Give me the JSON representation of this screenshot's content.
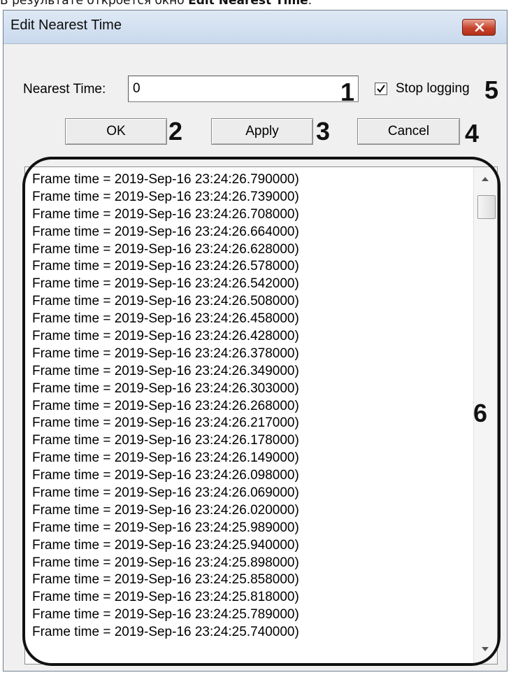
{
  "caption": {
    "prefix": "В результате откроется окно ",
    "bold": "Edit Nearest Time",
    "suffix": "."
  },
  "window": {
    "title": "Edit Nearest Time",
    "close_icon": "close-icon",
    "close_color": "#c7432c"
  },
  "nearest_time": {
    "label": "Nearest Time:",
    "value": "0"
  },
  "stop_logging": {
    "label": "Stop logging",
    "checked": true
  },
  "buttons": {
    "ok": "OK",
    "apply": "Apply",
    "cancel": "Cancel"
  },
  "callouts": {
    "c1": "1",
    "c2": "2",
    "c3": "3",
    "c4": "4",
    "c5": "5",
    "c6": "6"
  },
  "log": {
    "lines": [
      "Frame time = 2019-Sep-16 23:24:26.790000)",
      "Frame time = 2019-Sep-16 23:24:26.739000)",
      "Frame time = 2019-Sep-16 23:24:26.708000)",
      "Frame time = 2019-Sep-16 23:24:26.664000)",
      "Frame time = 2019-Sep-16 23:24:26.628000)",
      "Frame time = 2019-Sep-16 23:24:26.578000)",
      "Frame time = 2019-Sep-16 23:24:26.542000)",
      "Frame time = 2019-Sep-16 23:24:26.508000)",
      "Frame time = 2019-Sep-16 23:24:26.458000)",
      "Frame time = 2019-Sep-16 23:24:26.428000)",
      "Frame time = 2019-Sep-16 23:24:26.378000)",
      "Frame time = 2019-Sep-16 23:24:26.349000)",
      "Frame time = 2019-Sep-16 23:24:26.303000)",
      "Frame time = 2019-Sep-16 23:24:26.268000)",
      "Frame time = 2019-Sep-16 23:24:26.217000)",
      "Frame time = 2019-Sep-16 23:24:26.178000)",
      "Frame time = 2019-Sep-16 23:24:26.149000)",
      "Frame time = 2019-Sep-16 23:24:26.098000)",
      "Frame time = 2019-Sep-16 23:24:26.069000)",
      "Frame time = 2019-Sep-16 23:24:26.020000)",
      "Frame time = 2019-Sep-16 23:24:25.989000)",
      "Frame time = 2019-Sep-16 23:24:25.940000)",
      "Frame time = 2019-Sep-16 23:24:25.898000)",
      "Frame time = 2019-Sep-16 23:24:25.858000)",
      "Frame time = 2019-Sep-16 23:24:25.818000)",
      "Frame time = 2019-Sep-16 23:24:25.789000)",
      "Frame time = 2019-Sep-16 23:24:25.740000)"
    ]
  },
  "scrollbar": {
    "up_icon": "scroll-up-arrow-icon",
    "down_icon": "scroll-down-arrow-icon"
  }
}
